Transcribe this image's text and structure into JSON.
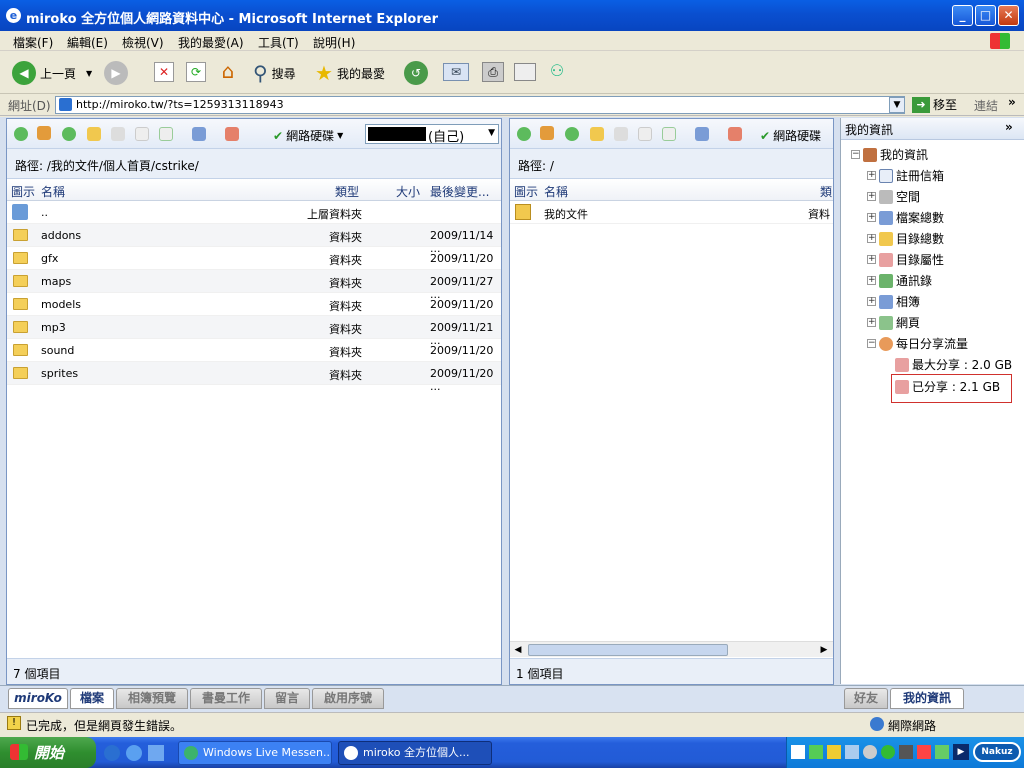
{
  "window": {
    "title": "miroko 全方位個人網路資料中心 - Microsoft Internet Explorer"
  },
  "menu": [
    "檔案(F)",
    "編輯(E)",
    "檢視(V)",
    "我的最愛(A)",
    "工具(T)",
    "說明(H)"
  ],
  "toolbar": {
    "back": "上一頁",
    "search": "搜尋",
    "favorites": "我的最愛"
  },
  "address": {
    "label": "網址(D)",
    "url": "http://miroko.tw/?ts=1259313118943",
    "go": "移至",
    "links": "連結"
  },
  "left_panel": {
    "drive_menu": "網路硬碟",
    "owner_suffix": "(自己)",
    "path": "路徑: /我的文件/個人首頁/cstrike/",
    "columns": {
      "icon": "圖示",
      "name": "名稱",
      "type": "類型",
      "size": "大小",
      "modified": "最後變更..."
    },
    "rows": [
      {
        "name": "..",
        "type": "上層資料夾",
        "size": "",
        "modified": ""
      },
      {
        "name": "addons",
        "type": "資料夾",
        "size": "",
        "modified": "2009/11/14 ..."
      },
      {
        "name": "gfx",
        "type": "資料夾",
        "size": "",
        "modified": "2009/11/20 ..."
      },
      {
        "name": "maps",
        "type": "資料夾",
        "size": "",
        "modified": "2009/11/27 ..."
      },
      {
        "name": "models",
        "type": "資料夾",
        "size": "",
        "modified": "2009/11/20 ..."
      },
      {
        "name": "mp3",
        "type": "資料夾",
        "size": "",
        "modified": "2009/11/21 ..."
      },
      {
        "name": "sound",
        "type": "資料夾",
        "size": "",
        "modified": "2009/11/20 ..."
      },
      {
        "name": "sprites",
        "type": "資料夾",
        "size": "",
        "modified": "2009/11/20 ..."
      }
    ],
    "status": "7 個項目"
  },
  "mid_panel": {
    "drive_menu": "網路硬碟",
    "path": "路徑: /",
    "columns": {
      "icon": "圖示",
      "name": "名稱",
      "type": "類"
    },
    "rows": [
      {
        "name": "我的文件",
        "type": "資料"
      }
    ],
    "status": "1 個項目"
  },
  "right_panel": {
    "header": "我的資訊",
    "tree": {
      "root": "我的資訊",
      "items": [
        "註冊信箱",
        "空間",
        "檔案總數",
        "目錄總數",
        "目錄屬性",
        "通訊錄",
        "相簿",
        "網頁",
        "每日分享流量"
      ],
      "share_max": "最大分享 : 2.0 GB",
      "share_used": "已分享 : 2.1 GB"
    }
  },
  "bottom_tabs": {
    "logo": "miroKo",
    "tabs": [
      "檔案",
      "相簿預覽",
      "書曼工作",
      "留言",
      "啟用序號"
    ],
    "right_tabs": [
      "好友",
      "我的資訊"
    ]
  },
  "statusbar": {
    "text": "已完成，但是網頁發生錯誤。",
    "zone": "網際網路"
  },
  "taskbar": {
    "start": "開始",
    "items": [
      "Windows Live Messen...",
      "miroko 全方位個人..."
    ],
    "tray_brand": "Nakuz"
  },
  "colors": {
    "accent": "#0A4FD0",
    "highlight_border": "#D0312D"
  }
}
